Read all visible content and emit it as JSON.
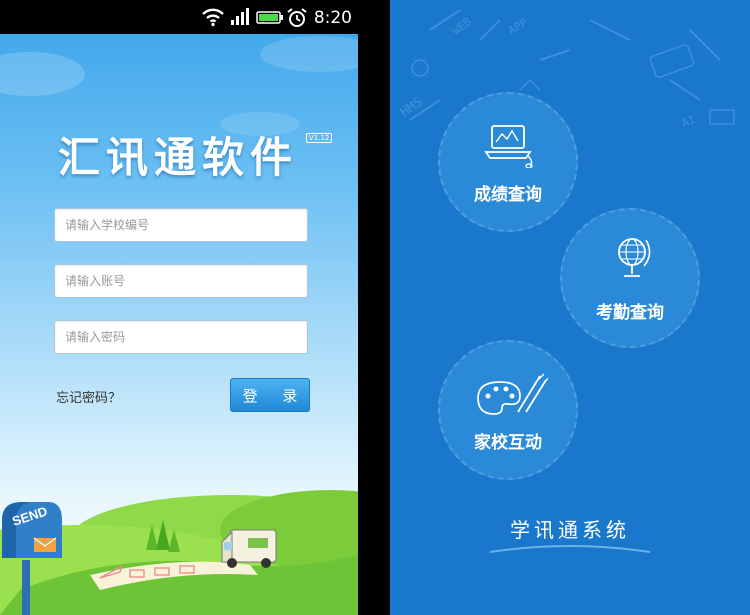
{
  "status_bar": {
    "time": "8:20"
  },
  "login": {
    "app_title": "汇讯通软件",
    "version": "V1.12",
    "school_placeholder": "请输入学校编号",
    "account_placeholder": "请输入账号",
    "password_placeholder": "请输入密码",
    "forgot_label": "忘记密码？",
    "login_label": "登 录",
    "mailbox_text": "SEND"
  },
  "menu": {
    "items": [
      {
        "label": "成绩查询",
        "icon": "laptop-icon"
      },
      {
        "label": "考勤查询",
        "icon": "globe-icon"
      },
      {
        "label": "家校互动",
        "icon": "palette-icon"
      }
    ],
    "footer": "学讯通系统",
    "deco_words": [
      "WEB",
      "APP",
      "HMS",
      "AI"
    ]
  },
  "colors": {
    "login_bg_top": "#3aa3ea",
    "menu_bg": "#1a78cc",
    "button": "#2a93e0"
  }
}
